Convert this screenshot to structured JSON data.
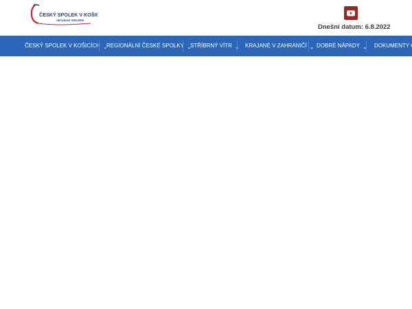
{
  "header": {
    "logo": {
      "line1": "ČESKÝ SPOLEK V KOŠICÍCH",
      "line2": "OBČANSKÉ SDRUŽENÍ"
    },
    "youtube_icon": "youtube-icon",
    "date_label": "Dnešní datum: 6.8.2022"
  },
  "nav": {
    "items": [
      {
        "label": "ČESKÝ SPOLEK V KOŠICÍCH",
        "has_dropdown": true
      },
      {
        "label": "REGIONÁLNÍ ČESKÉ SPOLKY",
        "has_dropdown": true
      },
      {
        "label": "STŘÍBRNÝ VÍTR",
        "has_dropdown": true
      },
      {
        "label": "KRAJANÉ V ZAHRANIČÍ",
        "has_dropdown": true
      },
      {
        "label": "DOBRÉ NÁPADY",
        "has_dropdown": true
      },
      {
        "label": "DOKUMENTY ČS",
        "has_dropdown": false
      }
    ],
    "chevron": "⌄"
  },
  "colors": {
    "nav_bg": "#2d66b8",
    "youtube_red": "#9c2620",
    "logo_blue": "#1f3f86",
    "logo_red": "#c8262c"
  }
}
